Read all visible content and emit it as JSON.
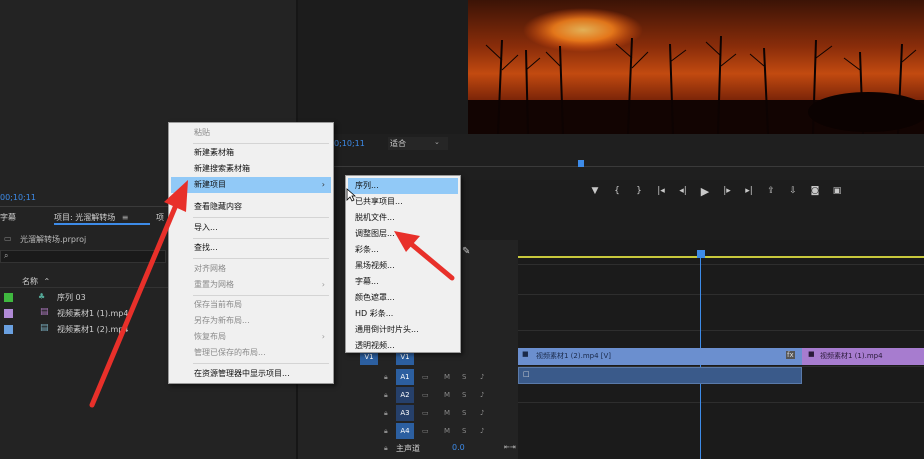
{
  "colors": {
    "accent_blue": "#3d8be8",
    "menu_highlight": "#91c9f7",
    "clip_video": "#6b8fcf",
    "clip_purple": "#a77ccf",
    "annotation_red": "#e8302a"
  },
  "monitor": {
    "timecode": "0;10;11",
    "fit_label": "适合"
  },
  "project": {
    "timecode": "00;10;11",
    "tab_captions": "字幕",
    "tab_project": "项目: 光溜解转场",
    "tab_more": "项",
    "file_name": "光溜解转场.prproj",
    "col_name": "名称",
    "items": [
      {
        "name": "序列 03",
        "color": "#3fb83f"
      },
      {
        "name": "视频素材1 (1).mp4",
        "color": "#b08ad6"
      },
      {
        "name": "视频素材1 (2).mp4",
        "color": "#6aa0e0"
      }
    ]
  },
  "context_menu": {
    "items": [
      {
        "label": "粘贴",
        "disabled": true
      },
      {
        "label": "新建素材箱",
        "disabled": false
      },
      {
        "label": "新建搜索素材箱",
        "disabled": false
      },
      {
        "label": "新建项目",
        "disabled": false,
        "has_submenu": true,
        "highlighted": true
      },
      {
        "label": "查看隐藏内容",
        "disabled": false
      },
      {
        "label": "导入...",
        "disabled": false
      },
      {
        "label": "查找...",
        "disabled": false
      },
      {
        "label": "对齐网格",
        "disabled": true
      },
      {
        "label": "重置为网格",
        "disabled": true,
        "has_submenu": true
      },
      {
        "label": "保存当前布局",
        "disabled": true
      },
      {
        "label": "另存为新布局...",
        "disabled": true
      },
      {
        "label": "恢复布局",
        "disabled": true,
        "has_submenu": true
      },
      {
        "label": "管理已保存的布局...",
        "disabled": true
      },
      {
        "label": "在资源管理器中显示项目...",
        "disabled": false
      }
    ]
  },
  "sub_menu": {
    "items": [
      {
        "label": "序列...",
        "highlighted": true
      },
      {
        "label": "已共享项目..."
      },
      {
        "label": "脱机文件..."
      },
      {
        "label": "调整图层..."
      },
      {
        "label": "彩条..."
      },
      {
        "label": "黑场视频..."
      },
      {
        "label": "字幕..."
      },
      {
        "label": "颜色遮罩..."
      },
      {
        "label": "HD 彩条..."
      },
      {
        "label": "通用倒计时片头..."
      },
      {
        "label": "透明视频..."
      }
    ]
  },
  "timeline": {
    "tracks": [
      "V1",
      "A1",
      "A2",
      "A3",
      "A4"
    ],
    "source_patch": "V1",
    "master_label": "主声道",
    "master_value": "0.0",
    "clip1_label": "视频素材1 (2).mp4 [V]",
    "clip2_label": "视频素材1 (1).mp4",
    "fx_label": "fx"
  }
}
